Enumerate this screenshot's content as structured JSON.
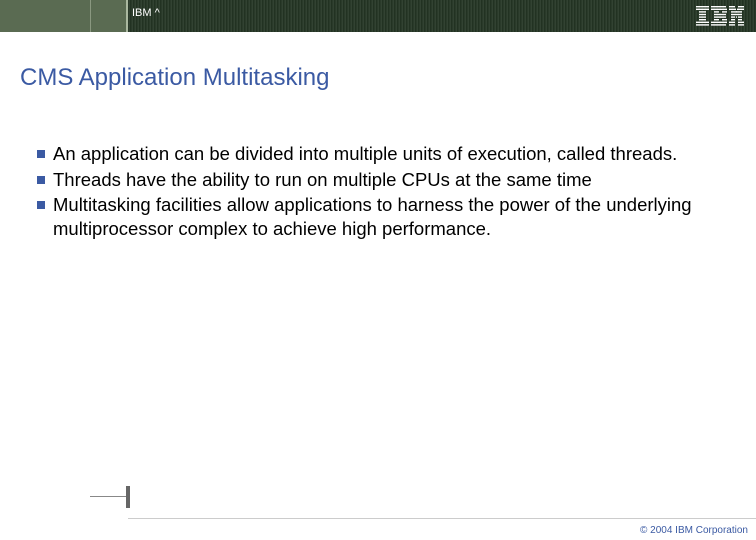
{
  "header": {
    "brand_label": "IBM ^"
  },
  "title": "CMS Application Multitasking",
  "bullets": [
    "An application can be divided into multiple units of execution, called threads.",
    "Threads have the ability to run on multiple CPUs at the same time",
    "Multitasking facilities allow applications to harness the power of the underlying multiprocessor complex to achieve high performance."
  ],
  "footer": {
    "copyright": "© 2004 IBM Corporation"
  },
  "colors": {
    "accent": "#3b5aa3",
    "header_bg": "#000000"
  }
}
